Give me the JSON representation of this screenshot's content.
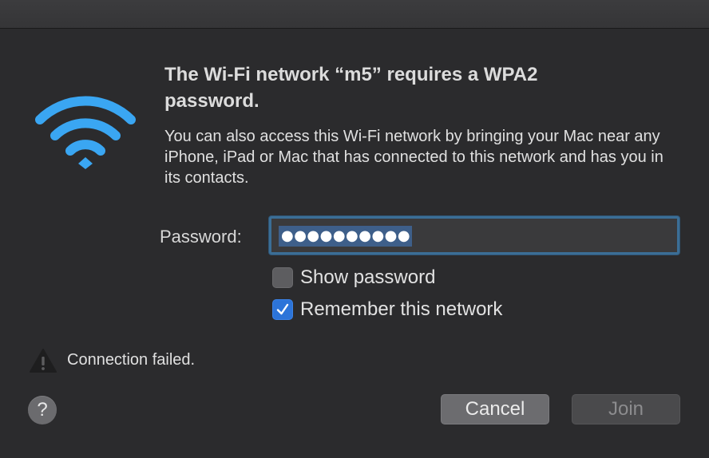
{
  "dialog": {
    "heading": "The Wi-Fi network “m5” requires a WPA2 password.",
    "description": "You can also access this Wi-Fi network by bringing your Mac near any iPhone, iPad or Mac that has connected to this network and has you in its contacts."
  },
  "password": {
    "label": "Password:",
    "masked_value": "●●●●●●●●●●"
  },
  "options": {
    "show_password": {
      "label": "Show password",
      "checked": false
    },
    "remember_network": {
      "label": "Remember this network",
      "checked": true
    }
  },
  "status": {
    "message": "Connection failed.",
    "icon": "warning-icon"
  },
  "buttons": {
    "help": "?",
    "cancel": "Cancel",
    "join": "Join"
  },
  "colors": {
    "accent": "#2c74d9",
    "wifi_icon": "#3aa6f2",
    "background": "#2b2b2d"
  }
}
